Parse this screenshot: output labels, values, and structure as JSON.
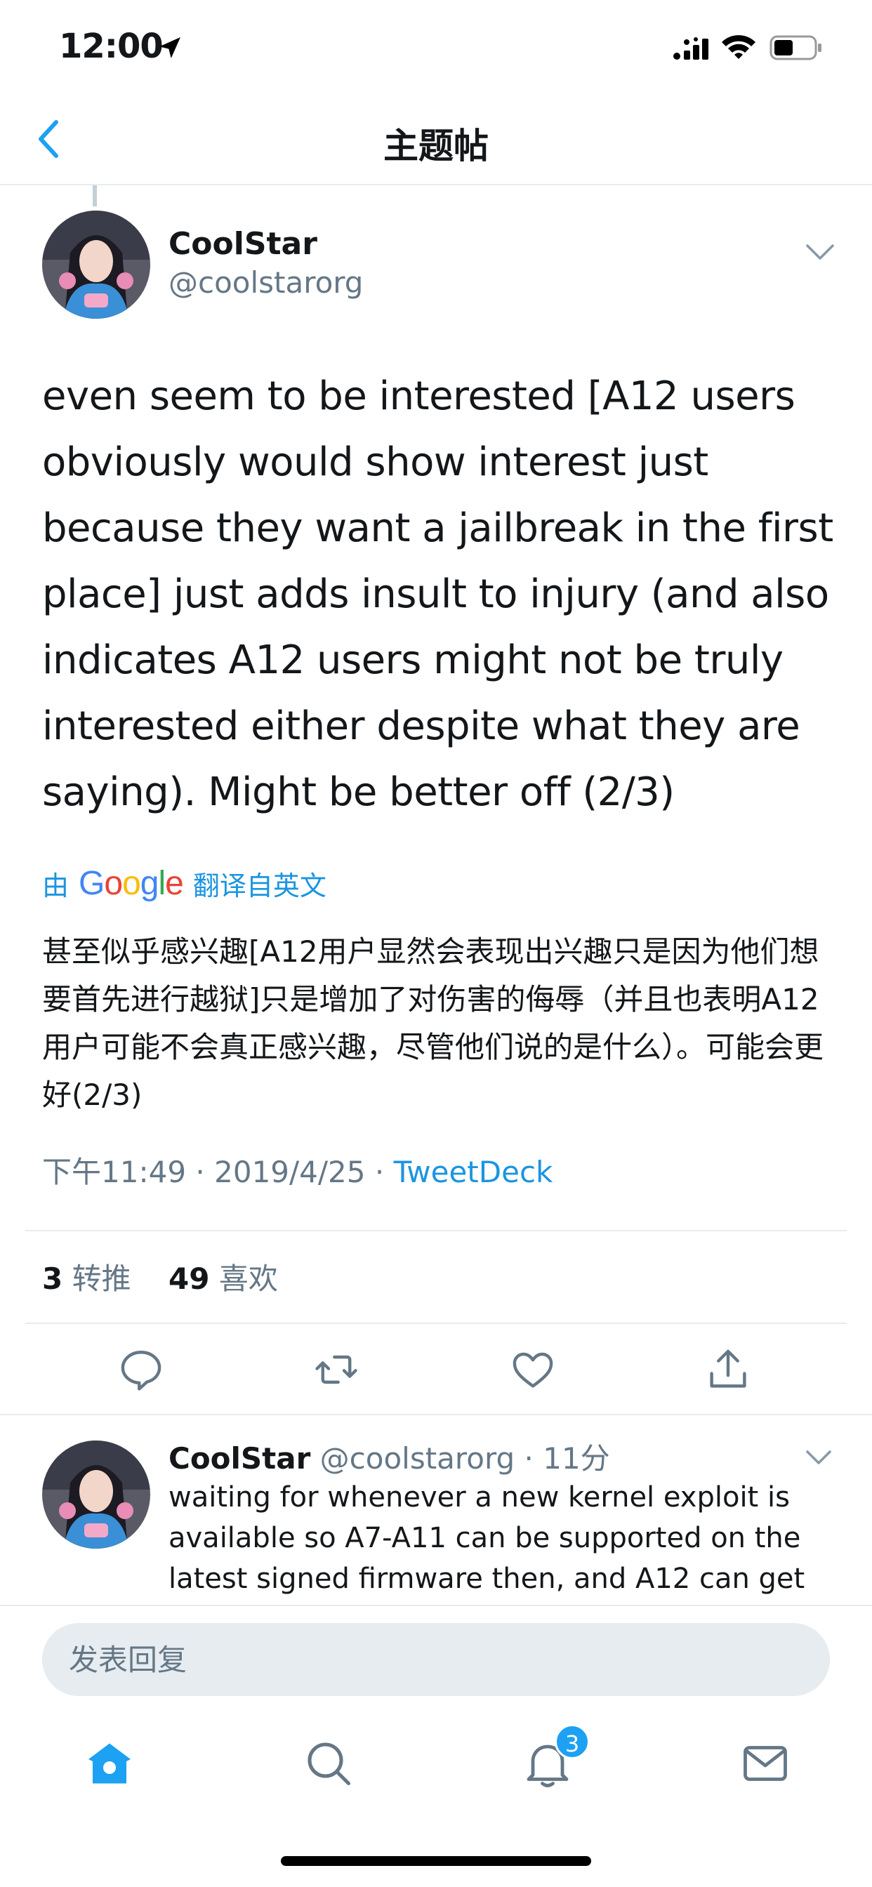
{
  "status_bar": {
    "time": "12:00"
  },
  "nav": {
    "title": "主题帖"
  },
  "tweet": {
    "author_name": "CoolStar",
    "author_handle": "@coolstarorg",
    "text": "even seem to be interested [A12 users obviously would show interest just because they want a jailbreak in the first place] just adds insult to injury (and also indicates A12 users might not be truly interested either despite what they are saying). Might be better off (2/3)",
    "translation_prefix": "由",
    "translation_google": "Google",
    "translation_suffix": "翻译自英文",
    "translated_text": "甚至似乎感兴趣[A12用户显然会表现出兴趣只是因为他们想要首先进行越狱]只是增加了对伤害的侮辱（并且也表明A12用户可能不会真正感兴趣，尽管他们说的是什么）。可能会更好(2/3)",
    "time": "下午11:49",
    "date": "2019/4/25",
    "separator": "·",
    "source": "TweetDeck",
    "retweet_count": "3",
    "retweet_label": "转推",
    "like_count": "49",
    "like_label": "喜欢"
  },
  "reply": {
    "author_name": "CoolStar",
    "author_handle": "@coolstarorg",
    "separator": "·",
    "time_ago": "11分",
    "text": "waiting for whenever a new kernel exploit is available so A7-A11 can be supported on the latest signed firmware then, and A12 can get"
  },
  "compose": {
    "placeholder": "发表回复"
  },
  "tab_bar": {
    "notifications_badge": "3"
  },
  "colors": {
    "accent": "#1da1f2",
    "link": "#1b95e0",
    "secondary_text": "#657786"
  },
  "icons": [
    "location-arrow-icon",
    "signal-icon",
    "wifi-icon",
    "battery-icon",
    "back-chevron-icon",
    "chevron-down-icon",
    "reply-icon",
    "retweet-icon",
    "like-icon",
    "share-icon",
    "home-icon",
    "search-icon",
    "notifications-icon",
    "messages-icon"
  ]
}
